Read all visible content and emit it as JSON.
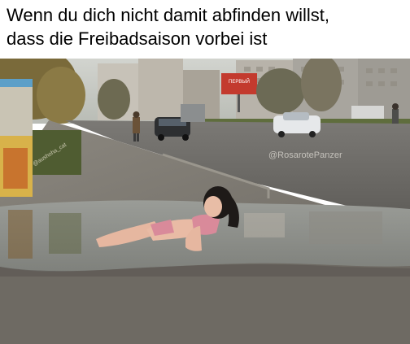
{
  "caption": {
    "line1": "Wenn du dich nicht damit abfinden willst,",
    "line2": "dass die Freibadsaison vorbei ist"
  },
  "photo": {
    "watermark_right": "@RosarotePanzer",
    "watermark_left": "@aushoha_cat",
    "billboard": "ПЕРВЫЙ"
  },
  "colors": {
    "sky": "#c9ccc6",
    "road": "#6e6c68",
    "puddle": "#8d8f8a",
    "grass": "#5c6a3a",
    "text": "#000000"
  }
}
